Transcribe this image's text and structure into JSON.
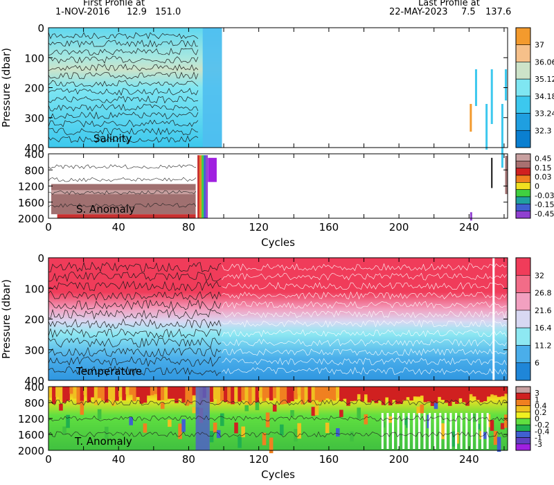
{
  "header": {
    "first_profile_label": "First Profile at",
    "first_profile_date": "1-NOV-2016",
    "first_profile_lat": "12.9",
    "first_profile_lon": "151.0",
    "last_profile_label": "Last Profile at",
    "last_profile_date": "22-MAY-2023",
    "last_profile_lat": "7.5",
    "last_profile_lon": "137.6"
  },
  "colors": {
    "salinity_fill": "#3cc8ee",
    "salinity_high": "#c9e0cc",
    "temperature_warm": "#f03c5a",
    "temperature_pink": "#f2a0c0",
    "temperature_cyan": "#8ee8f2",
    "temperature_blue": "#4aaeea",
    "anomaly_brown": "#a07070"
  },
  "chart_data": [
    {
      "type": "heatmap",
      "title": "Salinity",
      "xlabel": "",
      "ylabel": "Pressure (dbar)",
      "xlim": [
        0,
        262
      ],
      "ylim": [
        400,
        0
      ],
      "y_ticks": [
        "0",
        "100",
        "200",
        "300",
        "400"
      ],
      "colorbar": {
        "levels": [
          "37",
          "36.06",
          "35.12",
          "34.18",
          "33.24",
          "32.3"
        ],
        "colors": [
          "#f39a2d",
          "#f6c08a",
          "#cde3c9",
          "#7fe6f2",
          "#3cc8ee",
          "#1f9fe0",
          "#0a7fd0"
        ]
      },
      "data_extent_cycles": [
        0,
        99
      ],
      "sparse_profiles_cycles": [
        241,
        244,
        250,
        253,
        259,
        261
      ]
    },
    {
      "type": "heatmap",
      "title": "S. Anomaly",
      "xlabel": "Cycles",
      "ylabel": "",
      "xlim": [
        0,
        262
      ],
      "ylim": [
        2000,
        400
      ],
      "x_ticks": [
        "0",
        "40",
        "80",
        "120",
        "160",
        "200",
        "240"
      ],
      "y_ticks": [
        "400",
        "800",
        "1200",
        "1600",
        "2000"
      ],
      "colorbar": {
        "levels": [
          "0.45",
          "0.15",
          "0.03",
          "0",
          "-0.03",
          "-0.15",
          "-0.45"
        ],
        "colors": [
          "#c8a0a0",
          "#a87070",
          "#d02020",
          "#f08020",
          "#f0e020",
          "#40d040",
          "#20a0a0",
          "#4060d0",
          "#9040d0"
        ]
      }
    },
    {
      "type": "heatmap",
      "title": "Temperature",
      "xlabel": "",
      "ylabel": "Pressure (dbar)",
      "xlim": [
        0,
        262
      ],
      "ylim": [
        400,
        0
      ],
      "y_ticks": [
        "0",
        "100",
        "200",
        "300",
        "400"
      ],
      "colorbar": {
        "levels": [
          "32",
          "26.8",
          "21.6",
          "16.4",
          "11.2",
          "6"
        ],
        "colors": [
          "#f03c5a",
          "#f26c88",
          "#f2a0c0",
          "#d8d8f2",
          "#8ee8f2",
          "#4aaeea",
          "#1f86d8"
        ]
      },
      "data_extent_cycles": [
        0,
        262
      ]
    },
    {
      "type": "heatmap",
      "title": "T. Anomaly",
      "xlabel": "Cycles",
      "ylabel": "",
      "xlim": [
        0,
        262
      ],
      "ylim": [
        2000,
        400
      ],
      "x_ticks": [
        "0",
        "40",
        "80",
        "120",
        "160",
        "200",
        "240"
      ],
      "y_ticks": [
        "400",
        "800",
        "1200",
        "1600",
        "2000"
      ],
      "colorbar": {
        "levels": [
          "3",
          "1",
          "0.4",
          "0.2",
          "0",
          "-0.2",
          "-0.4",
          "-1",
          "-3"
        ],
        "colors": [
          "#c8a0a0",
          "#d02020",
          "#f08020",
          "#f0c020",
          "#f0f020",
          "#60e040",
          "#20b050",
          "#4060d0",
          "#6040c0",
          "#a020e0"
        ]
      }
    }
  ]
}
